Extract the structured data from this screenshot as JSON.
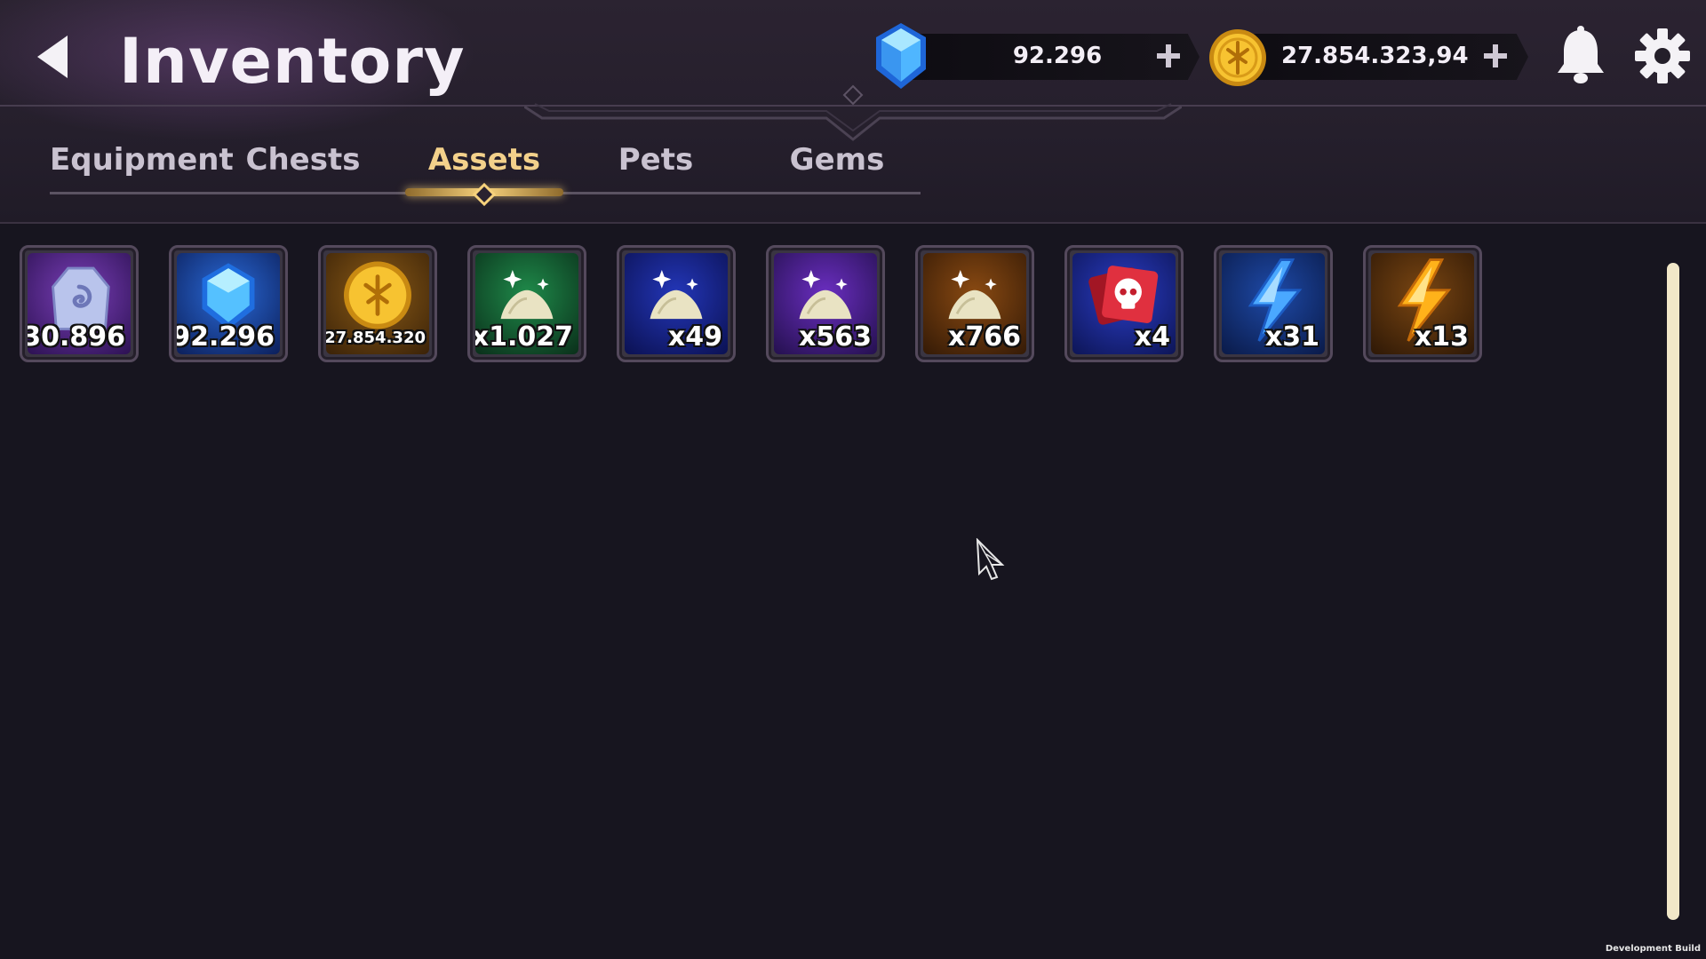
{
  "header": {
    "title": "Inventory",
    "gems_amount": "92.296",
    "gold_amount": "27.854.323,94"
  },
  "tabs": [
    {
      "label": "Equipment",
      "active": false
    },
    {
      "label": "Chests",
      "active": false
    },
    {
      "label": "Assets",
      "active": true
    },
    {
      "label": "Pets",
      "active": false
    },
    {
      "label": "Gems",
      "active": false
    }
  ],
  "items": [
    {
      "icon": "rune-stone-icon",
      "qty": "x30.896"
    },
    {
      "icon": "blue-gem-icon",
      "qty": "x92.296"
    },
    {
      "icon": "gold-coin-icon",
      "qty": "x27.854.320"
    },
    {
      "icon": "dust-pile-green-icon",
      "qty": "x1.027"
    },
    {
      "icon": "dust-pile-blue-icon",
      "qty": "x49"
    },
    {
      "icon": "dust-pile-purple-icon",
      "qty": "x563"
    },
    {
      "icon": "dust-pile-orange-icon",
      "qty": "x766"
    },
    {
      "icon": "skull-ticket-icon",
      "qty": "x4"
    },
    {
      "icon": "blue-lightning-icon",
      "qty": "x31"
    },
    {
      "icon": "gold-lightning-icon",
      "qty": "x13"
    }
  ],
  "footer": {
    "build_label": "Development Build"
  },
  "colors": {
    "background": "#17151f",
    "accent_gold": "#f3d18b",
    "scrollbar": "#f1e7c8"
  }
}
